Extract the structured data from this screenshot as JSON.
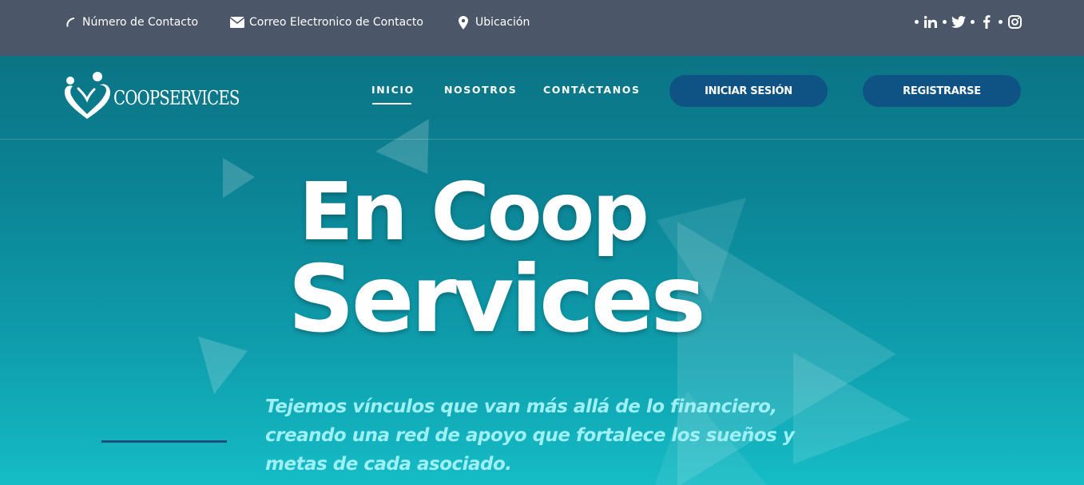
{
  "topbar": {
    "phone": "Número de Contacto",
    "email": "Correo Electronico de Contacto",
    "location": "Ubicación",
    "social": [
      "linkedin-icon",
      "twitter-icon",
      "facebook-icon",
      "instagram-icon"
    ]
  },
  "brand": {
    "name": "COOPSERVICES"
  },
  "nav": {
    "inicio": "INICIO",
    "nosotros": "NOSOTROS",
    "contactanos": "CONTÁCTANOS",
    "login": "INICIAR SESIÓN",
    "register": "REGISTRARSE"
  },
  "hero": {
    "title_line1": "En Coop",
    "title_line2": "Services",
    "tagline_1": "Tejemos vínculos que van más allá de lo financiero,",
    "tagline_2": "creando una red de apoyo que fortalece los sueños y",
    "tagline_3": "metas de cada asociado."
  },
  "colors": {
    "topbar_bg": "#4b5668",
    "hero_top": "#0b7485",
    "hero_bottom": "#15bcc6",
    "button_bg": "#0e5384",
    "tagline": "#9ff0f4",
    "accent_line": "#1d4f7e"
  }
}
